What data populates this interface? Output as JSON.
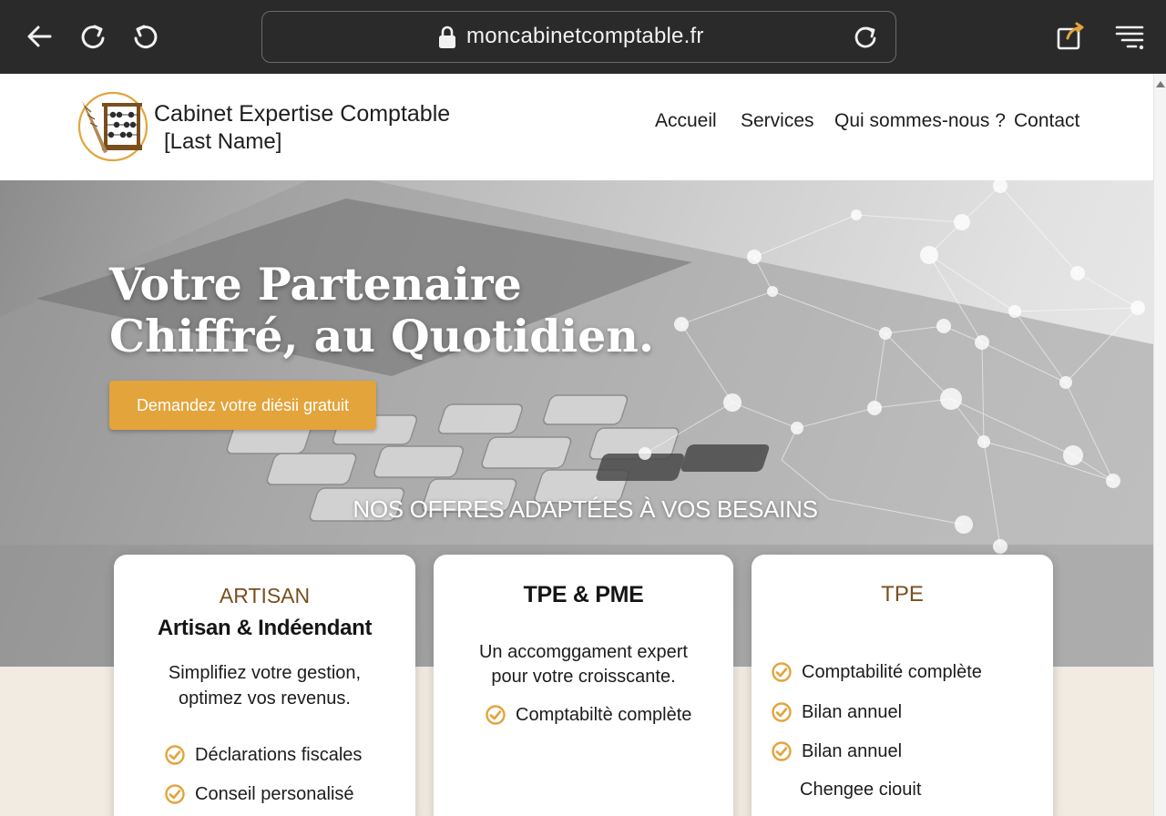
{
  "browser": {
    "url": "moncabinetcomptable.fr"
  },
  "header": {
    "brand_line1": "Cabinet Expertise Comptable",
    "brand_line2": "[Last Name]",
    "nav": [
      {
        "label": "Accueil"
      },
      {
        "label": "Services"
      },
      {
        "label": "Qui sommes-nous ?"
      },
      {
        "label": "Contact"
      }
    ]
  },
  "hero": {
    "title_line1": "Votre Partenaire",
    "title_line2": "Chiffré, au Quotidien.",
    "cta_label": "Demandez votre diésii gratuit",
    "section_title": "NOS OFFRES ADAPTÉES À VOS BESAINS"
  },
  "offers": [
    {
      "eyebrow": "ARTISAN",
      "title": "Artisan & Indéendant",
      "desc_line1": "Simplifiez votre gestion,",
      "desc_line2": "optimez vos revenus.",
      "features": [
        "Déclarations fiscales",
        "Conseil personalisé"
      ]
    },
    {
      "title": "TPE & PME",
      "desc_line1": "Un accomggament expert",
      "desc_line2": "pour votre croisscante.",
      "features": [
        "Comptabiltè complète"
      ]
    },
    {
      "eyebrow": "TPE",
      "features": [
        "Comptabilité complète",
        "Bilan annuel",
        "Bilan annuel"
      ],
      "extra": "Chengee ciouit"
    }
  ],
  "colors": {
    "accent": "#e3a43c",
    "eyebrow": "#7a4f1e",
    "chrome_bg": "#2a2a2a",
    "band": "#f1ebe1"
  }
}
